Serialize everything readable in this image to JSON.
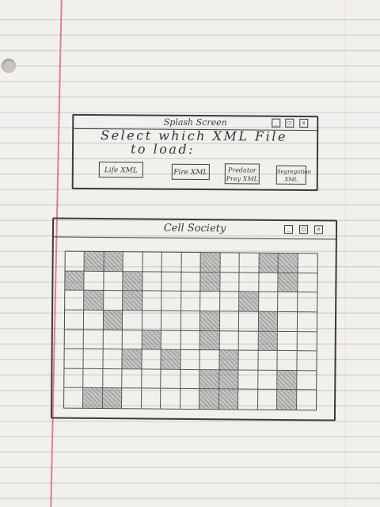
{
  "splash": {
    "title": "Splash Screen",
    "prompt_line1": "Select which XML File",
    "prompt_line2": "to load:",
    "buttons": [
      "Life XML",
      "Fire XML",
      "Predator Prey XML",
      "Segregation XML"
    ],
    "controls": {
      "minimize": "_",
      "maximize": "□",
      "close": "x"
    }
  },
  "society": {
    "title": "Cell Society",
    "controls": {
      "minimize": "_",
      "maximize": "□",
      "close": "x"
    },
    "grid": {
      "rows": 8,
      "cols": 13,
      "cells": [
        [
          0,
          1,
          1,
          0,
          0,
          0,
          0,
          1,
          0,
          0,
          1,
          1,
          0
        ],
        [
          1,
          0,
          0,
          1,
          0,
          0,
          0,
          1,
          0,
          0,
          0,
          1,
          0
        ],
        [
          0,
          1,
          0,
          1,
          0,
          0,
          0,
          0,
          0,
          1,
          0,
          0,
          0
        ],
        [
          0,
          0,
          1,
          0,
          0,
          0,
          0,
          1,
          0,
          0,
          1,
          0,
          0
        ],
        [
          0,
          0,
          0,
          0,
          1,
          0,
          0,
          1,
          0,
          0,
          1,
          0,
          0
        ],
        [
          0,
          0,
          0,
          1,
          0,
          1,
          0,
          0,
          1,
          0,
          0,
          0,
          0
        ],
        [
          0,
          0,
          0,
          0,
          0,
          0,
          0,
          1,
          1,
          0,
          0,
          1,
          0
        ],
        [
          0,
          1,
          1,
          0,
          0,
          0,
          0,
          1,
          1,
          0,
          0,
          1,
          0
        ]
      ]
    }
  }
}
